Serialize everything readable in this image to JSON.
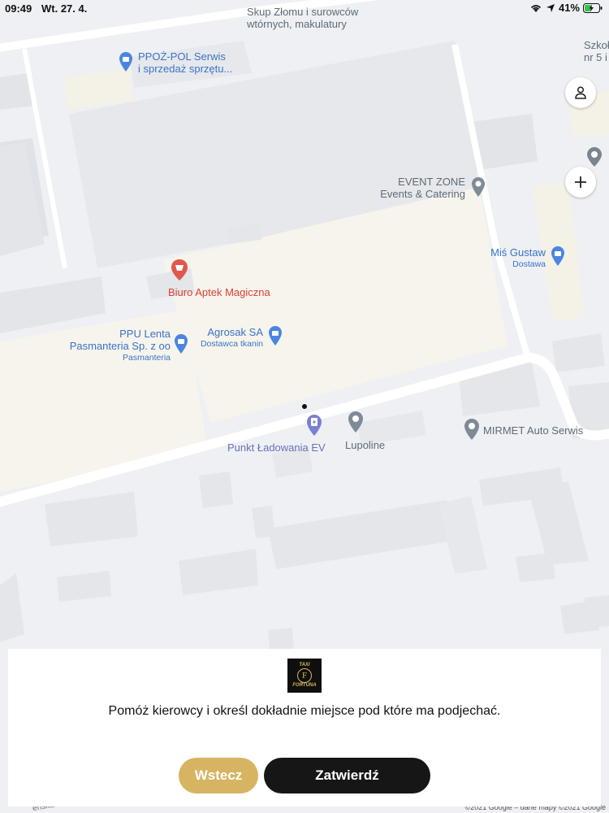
{
  "status_bar": {
    "time": "09:49",
    "date": "Wt. 27. 4.",
    "battery": "41%"
  },
  "map": {
    "pois": [
      {
        "id": "skup",
        "lines": [
          "Skup Złomu i surowców",
          "wtórnych, makulatury"
        ]
      },
      {
        "id": "ppoz",
        "lines": [
          "PPOŻ-POL Serwis",
          "i sprzedaż sprzętu..."
        ]
      },
      {
        "id": "szkol",
        "lines": [
          "Szkoł",
          "nr 5 i"
        ]
      },
      {
        "id": "event",
        "lines": [
          "EVENT ZONE",
          "Events & Catering"
        ]
      },
      {
        "id": "mis",
        "lines": [
          "Miś Gustaw"
        ],
        "sub": "Dostawa"
      },
      {
        "id": "biuro",
        "lines": [
          "Biuro Aptek Magiczna"
        ]
      },
      {
        "id": "ppu",
        "lines": [
          "PPU Lenta",
          "Pasmanteria Sp. z oo"
        ],
        "sub": "Pasmanteria"
      },
      {
        "id": "agrosak",
        "lines": [
          "Agrosak SA"
        ],
        "sub": "Dostawca tkanin"
      },
      {
        "id": "punkt",
        "lines": [
          "Punkt Ładowania EV"
        ]
      },
      {
        "id": "lupoline",
        "lines": [
          "Lupoline"
        ]
      },
      {
        "id": "mirmet",
        "lines": [
          "MIRMET Auto Serwis"
        ]
      }
    ],
    "street_fragment": "eńska",
    "attribution": "©2021 Google – dane mapy ©2021 Google"
  },
  "sheet": {
    "logo": {
      "top": "TAXI",
      "mark": "F",
      "bottom": "FORTUNA"
    },
    "message": "Pomóż kierowcy i określ dokładnie miejsce pod które ma podjechać.",
    "back_label": "Wstecz",
    "confirm_label": "Zatwierdź"
  },
  "colors": {
    "accent_gold": "#d6b462",
    "confirm_dark": "#161616",
    "poi_blue": "#3a73c9",
    "poi_red": "#d94035"
  },
  "icons": {
    "profile": "person-icon",
    "add": "plus-icon",
    "location": "location-arrow-icon"
  }
}
